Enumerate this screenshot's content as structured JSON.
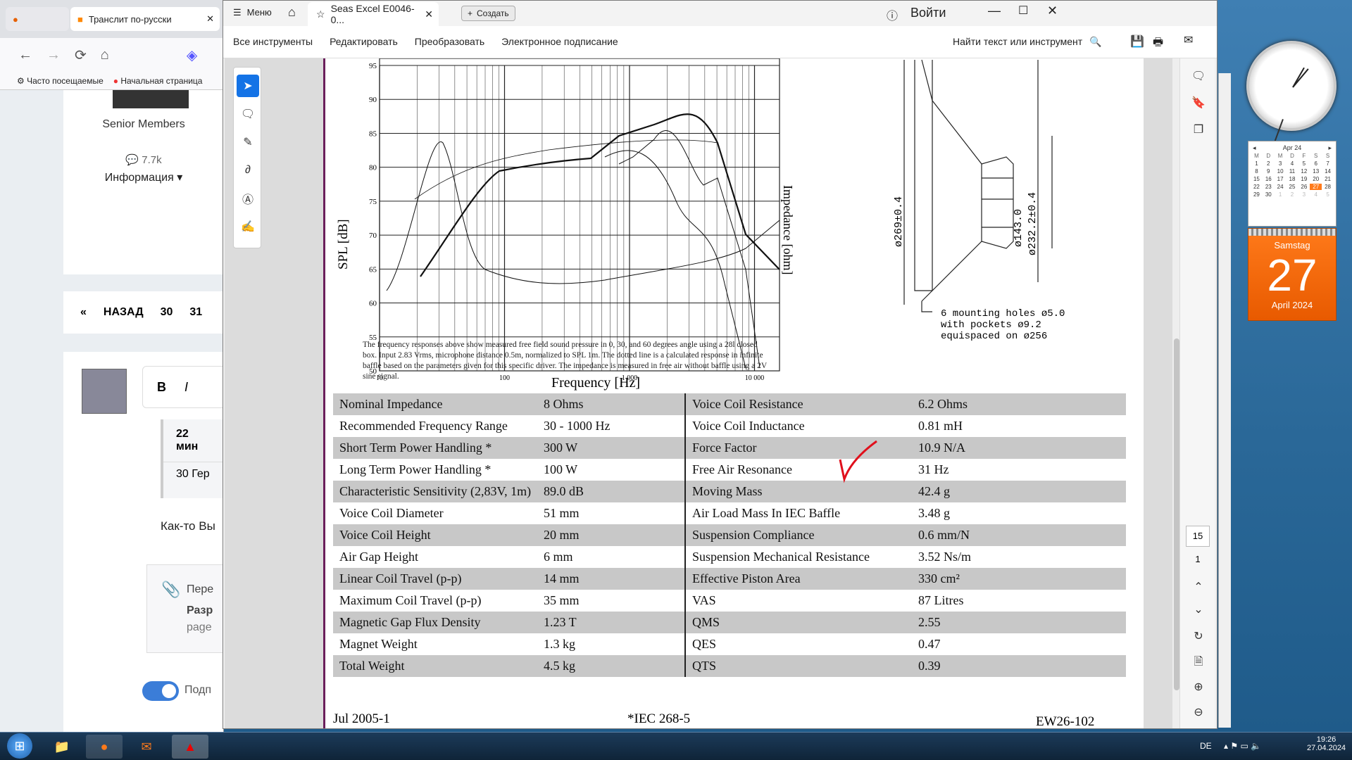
{
  "firefox": {
    "tab1": "",
    "tab2": "Транслит по-русски",
    "bookmark1": "Часто посещаемые",
    "bookmark2": "Начальная страница",
    "members": "Senior Members",
    "count": "7.7k",
    "info": "Информация ▾",
    "pager": {
      "back": "НАЗАД",
      "p1": "30",
      "p2": "31"
    },
    "bold": "B",
    "italic": "I",
    "quote1": "22 мин",
    "quote2": "30 Гер",
    "text1": "Как-то Вы",
    "attach1": "Пере",
    "attach2": "Разр",
    "attach3": "page",
    "toggle_label": "Подп"
  },
  "acrobat": {
    "menu": "Меню",
    "tab_title": "Seas Excel E0046-0...",
    "create": "Создать",
    "login": "Войти",
    "tools": [
      "Все инструменты",
      "Редактировать",
      "Преобразовать",
      "Электронное подписание"
    ],
    "find": "Найти текст или инструмент",
    "page_num": "15",
    "page_total": "1"
  },
  "doc": {
    "chart_title": "",
    "ylabel": "SPL [dB]",
    "y2label": "Impedance [ohm]",
    "xlabel": "Frequency [Hz]",
    "yticks": [
      "95",
      "90",
      "85",
      "80",
      "75",
      "70",
      "65",
      "60",
      "55",
      "50"
    ],
    "xticks": [
      "10",
      "100",
      "1 000",
      "10 000"
    ],
    "caption": "The frequency responses above show measured free field sound pressure in 0, 30, and 60 degrees angle using a 28l closed box. Input 2.83 Vrms, microphone distance 0.5m, normalized to SPL 1m. The dotted line is a calculated response in infinite baffle based on the parameters given for this specific driver. The impedance is measured in free air without baffle using a 2V sine signal.",
    "drawing": {
      "d1": "ø269±0.4",
      "d2": "ø143.0",
      "d3": "ø232.2±0.4",
      "note1": "6 mounting holes ø5.0",
      "note2": "with pockets ø9.2",
      "note3": "equispaced on ø256"
    },
    "specs": [
      [
        "Nominal Impedance",
        "8 Ohms",
        "Voice Coil Resistance",
        "6.2 Ohms"
      ],
      [
        "Recommended Frequency Range",
        "30 - 1000 Hz",
        "Voice Coil Inductance",
        "0.81 mH"
      ],
      [
        "Short Term Power Handling *",
        "300 W",
        "Force Factor",
        "10.9 N/A"
      ],
      [
        "Long Term Power Handling *",
        "100 W",
        "Free Air Resonance",
        "31 Hz"
      ],
      [
        "Characteristic Sensitivity (2,83V, 1m)",
        "89.0 dB",
        "Moving Mass",
        "42.4 g"
      ],
      [
        "Voice Coil Diameter",
        "51 mm",
        "Air Load Mass In IEC Baffle",
        "3.48 g"
      ],
      [
        "Voice Coil Height",
        "20 mm",
        "Suspension Compliance",
        "0.6 mm/N"
      ],
      [
        "Air Gap Height",
        "6 mm",
        "Suspension Mechanical Resistance",
        "3.52 Ns/m"
      ],
      [
        "Linear Coil Travel (p-p)",
        "14 mm",
        "Effective Piston Area",
        "330 cm²"
      ],
      [
        "Maximum Coil Travel (p-p)",
        "35 mm",
        "VAS",
        "87 Litres"
      ],
      [
        "Magnetic Gap Flux Density",
        "1.23 T",
        "QMS",
        "2.55"
      ],
      [
        "Magnet Weight",
        "1.3 kg",
        "QES",
        "0.47"
      ],
      [
        "Total Weight",
        "4.5 kg",
        "QTS",
        "0.39"
      ]
    ],
    "footer_left": "Jul 2005-1",
    "footer_mid": "*IEC 268-5",
    "footer_right": "EW26-102"
  },
  "gadgets": {
    "cal_month": "Apr 24",
    "day_name": "Samstag",
    "day": "27",
    "month_year": "April 2024",
    "cal_head": [
      "M",
      "D",
      "M",
      "D",
      "F",
      "S",
      "S"
    ],
    "cal_rows": [
      [
        "1",
        "2",
        "3",
        "4",
        "5",
        "6",
        "7"
      ],
      [
        "8",
        "9",
        "10",
        "11",
        "12",
        "13",
        "14"
      ],
      [
        "15",
        "16",
        "17",
        "18",
        "19",
        "20",
        "21"
      ],
      [
        "22",
        "23",
        "24",
        "25",
        "26",
        "27",
        "28"
      ],
      [
        "29",
        "30",
        "1",
        "2",
        "3",
        "4",
        "5"
      ]
    ]
  },
  "taskbar": {
    "lang": "DE",
    "time": "19:26",
    "date": "27.04.2024"
  }
}
